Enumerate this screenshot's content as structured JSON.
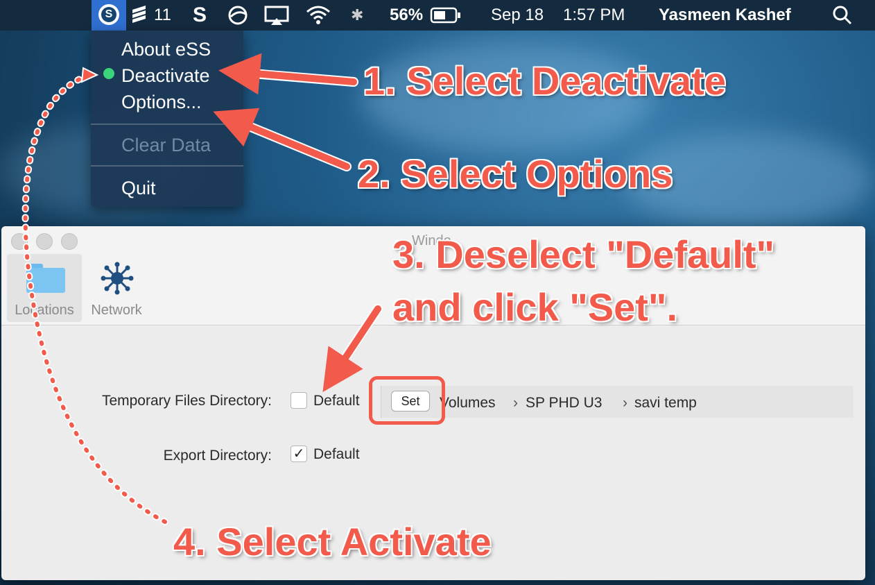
{
  "menubar": {
    "app_icon": "ess-logo-icon",
    "badge_count": "11",
    "battery_percent": "56%",
    "date": "Sep 18",
    "time": "1:57 PM",
    "user_name": "Yasmeen Kashef"
  },
  "dropdown": {
    "items": [
      {
        "label": "About eSS"
      },
      {
        "label": "Deactivate",
        "active_indicator_color": "#3ad57a"
      },
      {
        "label": "Options..."
      },
      {
        "label": "Clear Data",
        "disabled": true
      },
      {
        "label": "Quit"
      }
    ]
  },
  "window": {
    "title": "Windo",
    "tabs": [
      {
        "label": "Locations",
        "icon": "folder-icon",
        "selected": true
      },
      {
        "label": "Network",
        "icon": "network-icon"
      }
    ],
    "fields": {
      "temp_dir_label": "Temporary Files Directory:",
      "temp_default_label": "Default",
      "temp_default_checked": false,
      "set_button_label": "Set",
      "path_parts": [
        "Volumes",
        "SP PHD U3",
        "savi temp"
      ],
      "export_dir_label": "Export Directory:",
      "export_default_label": "Default",
      "export_default_checked": true
    }
  },
  "annotations": {
    "step1": "1. Select Deactivate",
    "step2": "2. Select Options",
    "step3_line1": "3. Deselect \"Default\"",
    "step3_line2": "and click \"Set\".",
    "step4": "4. Select Activate",
    "color": "#f25a4b"
  }
}
